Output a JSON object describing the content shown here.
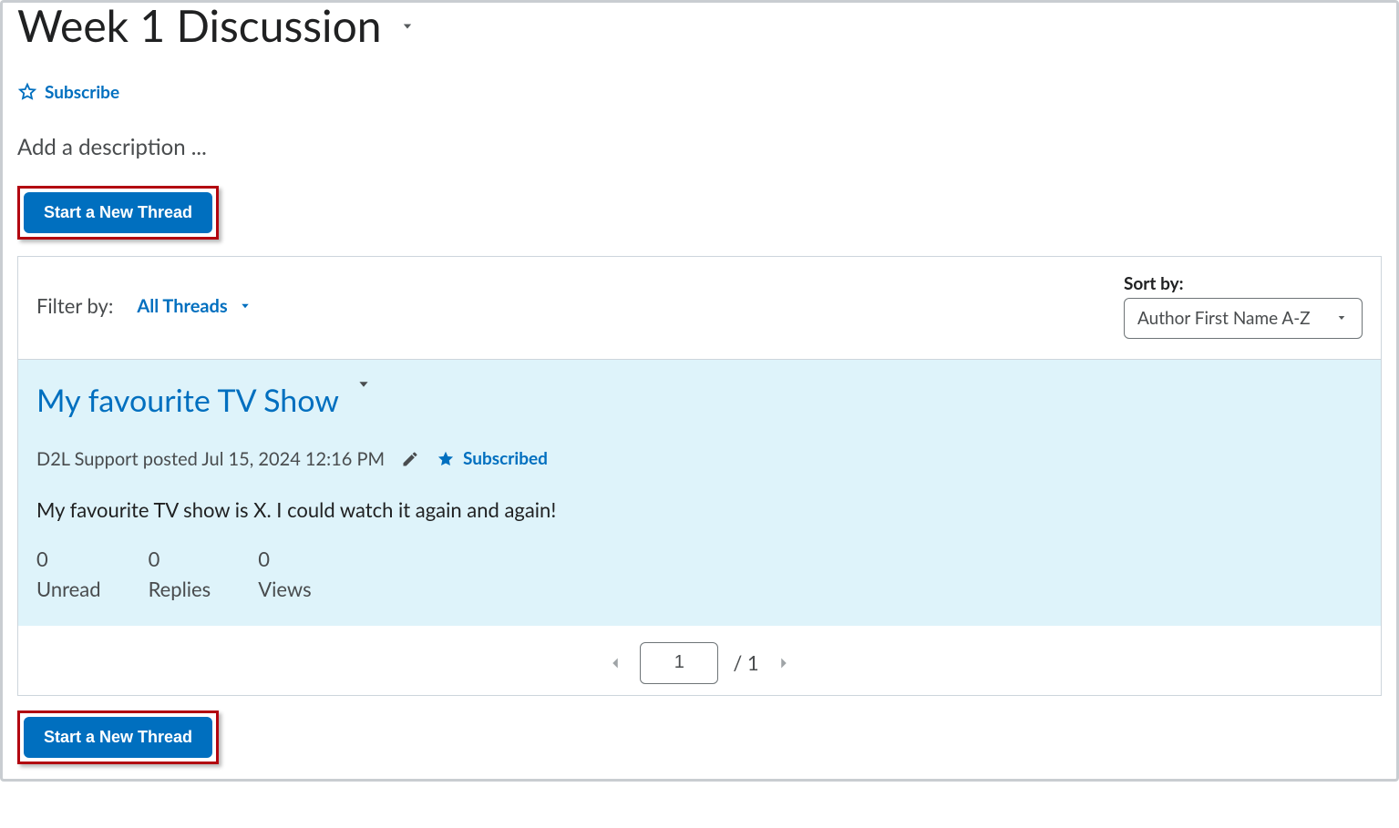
{
  "header": {
    "title": "Week 1 Discussion",
    "subscribe_label": "Subscribe",
    "description": "Add a description ..."
  },
  "buttons": {
    "new_thread": "Start a New Thread"
  },
  "filter": {
    "label": "Filter by:",
    "value": "All Threads",
    "sort_label": "Sort by:",
    "sort_value": "Author First Name A-Z"
  },
  "thread": {
    "title": "My favourite TV Show",
    "author": "D2L Support",
    "posted_verb": "posted",
    "timestamp": "Jul 15, 2024 12:16 PM",
    "subscribed_label": "Subscribed",
    "body": "My favourite TV show is X. I could watch it again and again!",
    "stats": {
      "unread_count": "0",
      "unread_label": "Unread",
      "replies_count": "0",
      "replies_label": "Replies",
      "views_count": "0",
      "views_label": "Views"
    }
  },
  "pagination": {
    "current": "1",
    "total": "1",
    "sep": "/"
  }
}
